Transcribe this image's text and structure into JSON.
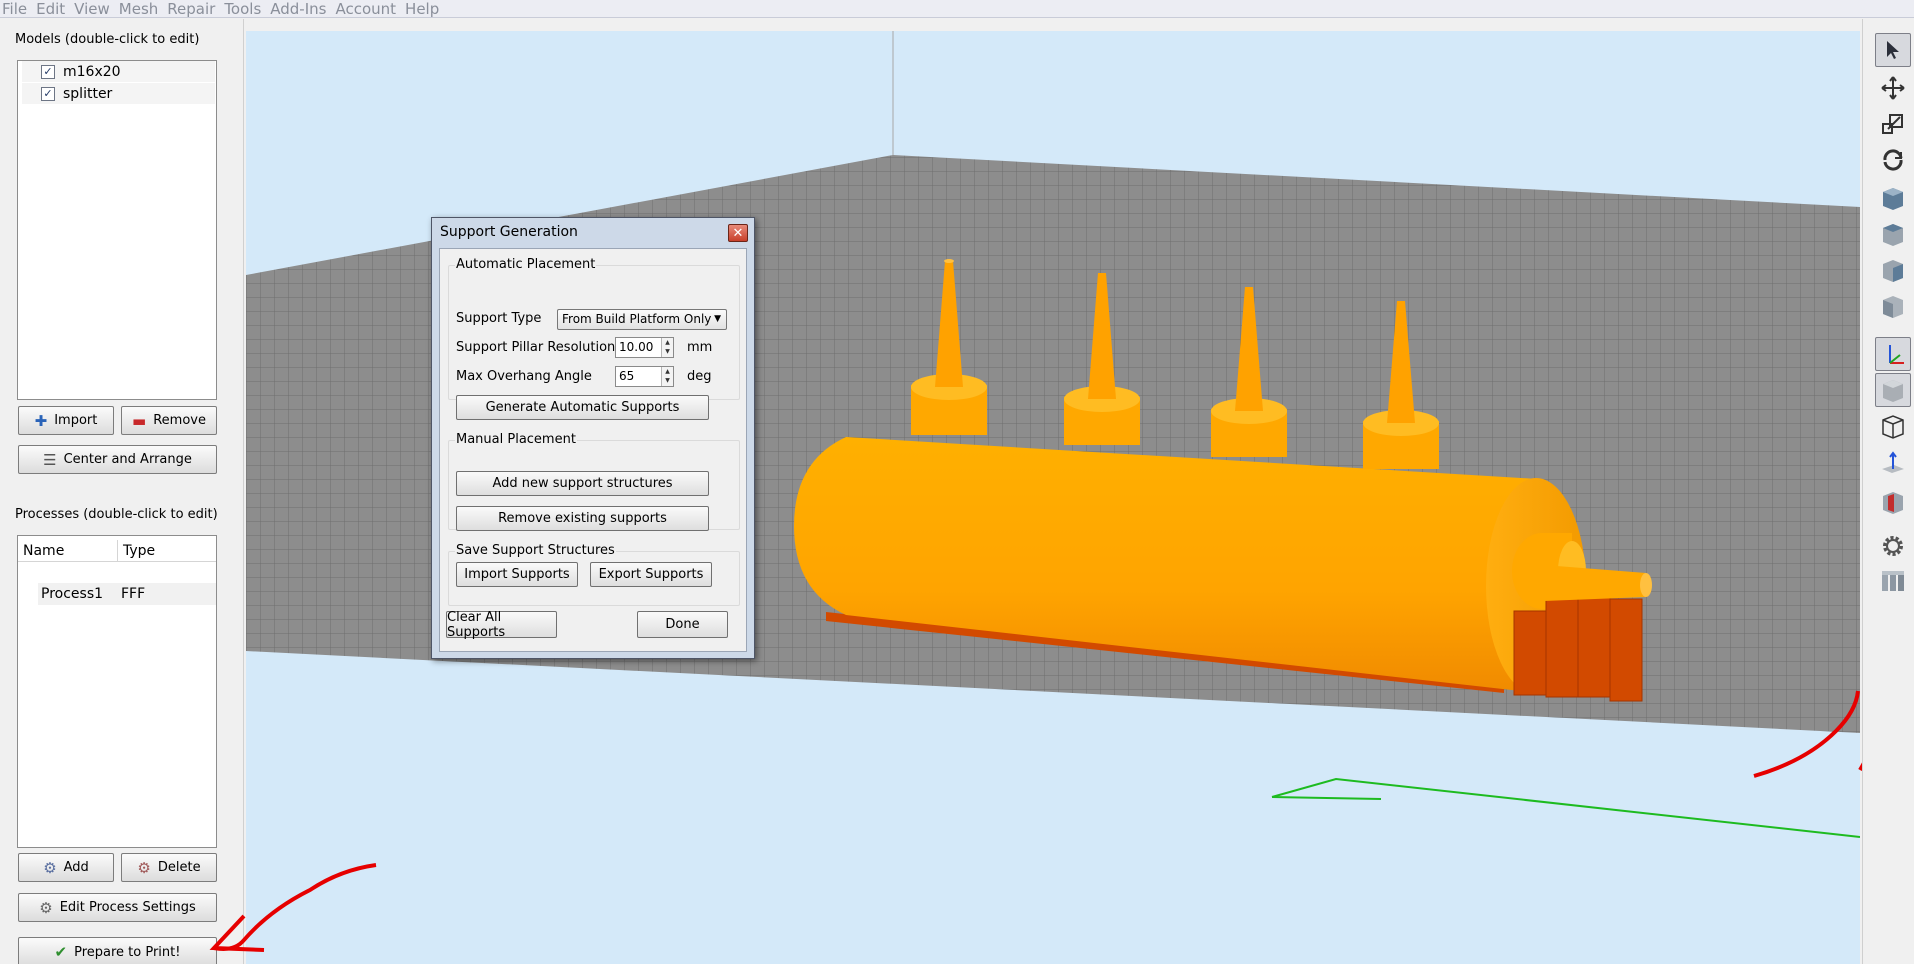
{
  "menu": [
    "File",
    "Edit",
    "View",
    "Mesh",
    "Repair",
    "Tools",
    "Add-Ins",
    "Account",
    "Help"
  ],
  "models": {
    "title": "Models (double-click to edit)",
    "items": [
      {
        "name": "m16x20",
        "checked": true
      },
      {
        "name": "splitter",
        "checked": true
      }
    ],
    "import_label": "Import",
    "remove_label": "Remove",
    "center_label": "Center and Arrange"
  },
  "processes": {
    "title": "Processes (double-click to edit)",
    "col_name": "Name",
    "col_type": "Type",
    "rows": [
      {
        "name": "Process1",
        "type": "FFF"
      }
    ],
    "add_label": "Add",
    "delete_label": "Delete",
    "edit_label": "Edit Process Settings",
    "prepare_label": "Prepare to Print!"
  },
  "dialog": {
    "title": "Support Generation",
    "auto": {
      "legend": "Automatic Placement",
      "support_type_label": "Support Type",
      "support_type_value": "From Build Platform Only",
      "pillar_label": "Support Pillar Resolution",
      "pillar_value": "10.00",
      "pillar_unit": "mm",
      "angle_label": "Max Overhang Angle",
      "angle_value": "65",
      "angle_unit": "deg",
      "generate_label": "Generate Automatic Supports"
    },
    "manual": {
      "legend": "Manual Placement",
      "add_label": "Add new support structures",
      "remove_label": "Remove existing supports"
    },
    "save": {
      "legend": "Save Support Structures",
      "import_label": "Import Supports",
      "export_label": "Export Supports"
    },
    "clear_label": "Clear All Supports",
    "done_label": "Done"
  },
  "toolbar_icons": [
    "select-cursor-icon",
    "move-icon",
    "scale-icon",
    "rotate-icon",
    "view-front-icon",
    "view-top-icon",
    "view-side-icon",
    "view-iso-icon",
    "axes-icon",
    "solid-view-icon",
    "wireframe-view-icon",
    "normals-icon",
    "cross-section-icon",
    "settings-gear-icon",
    "supports-icon"
  ],
  "colors": {
    "viewport_bg": "#d4e9f9",
    "bed": "#8d8d8d",
    "model": "#ffa400",
    "support": "#d24a00",
    "annotation": "#e60000"
  }
}
